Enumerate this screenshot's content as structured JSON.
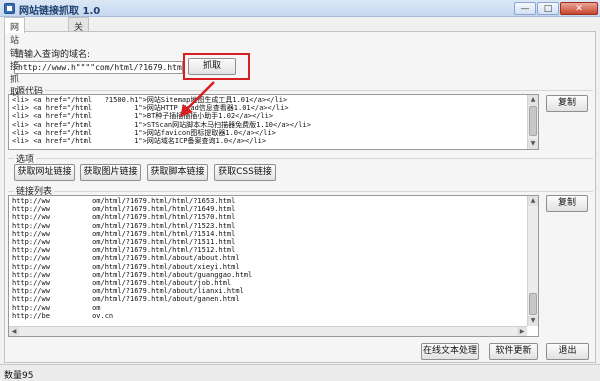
{
  "window": {
    "title": "网站链接抓取 1.0",
    "minimize": "—",
    "maximize": "□",
    "close": "✕"
  },
  "tabs": [
    {
      "label": "网站链接抓取"
    },
    {
      "label": "关于"
    }
  ],
  "domain_section": {
    "prompt": "请输入查询的域名:",
    "url_value": "http://www.h\"\"\"\"com/html/?1679.html",
    "fetch_button": "抓取"
  },
  "source_section": {
    "label": "源代码",
    "copy_button": "复制",
    "lines": [
      "<li> <a href=\"/html   ?1500.h1\">网站Sitemap地图生成工具1.01</a></li>",
      "<li> <a href=\"/html          1\">网站HTTP Head信息查看器1.01</a></li>",
      "<li> <a href=\"/html          1\">BT种子插插插插小助手1.02</a></li>",
      "<li> <a href=\"/html          1\">STScan网站脚本木马扫描器免费版1.10</a></li>",
      "<li> <a href=\"/html          1\">网站favicon图标提取器1.0</a></li>",
      "<li> <a href=\"/html          1\">网站域名ICP备案查询1.0</a></li>"
    ]
  },
  "options_section": {
    "label": "选项",
    "buttons": [
      "获取网址链接",
      "获取图片链接",
      "获取脚本链接",
      "获取CSS链接"
    ]
  },
  "links_section": {
    "label": "链接列表",
    "copy_button": "复制",
    "lines": [
      "http://ww          om/html/?1679.html/html/?1653.html",
      "http://ww          om/html/?1679.html/html/?1649.html",
      "http://ww          om/html/?1679.html/html/?1570.html",
      "http://ww          om/html/?1679.html/html/?1523.html",
      "http://ww          om/html/?1679.html/html/?1514.html",
      "http://ww          om/html/?1679.html/html/?1511.html",
      "http://ww          om/html/?1679.html/html/?1512.html",
      "http://ww          om/html/?1679.html/about/about.html",
      "http://ww          om/html/?1679.html/about/xieyi.html",
      "http://ww          om/html/?1679.html/about/guanggao.html",
      "http://ww          om/html/?1679.html/about/job.html",
      "http://ww          om/html/?1679.html/about/lianxi.html",
      "http://ww          om/html/?1679.html/about/ganen.html",
      "http://ww          om",
      "http://be          ov.cn"
    ]
  },
  "bottom_buttons": {
    "online_text": "在线文本处理",
    "update": "软件更新",
    "exit": "退出"
  },
  "status": {
    "count_text": "数量95"
  },
  "colors": {
    "highlight_box": "#d81f1f",
    "annotation_arrow": "#d81f1f"
  }
}
